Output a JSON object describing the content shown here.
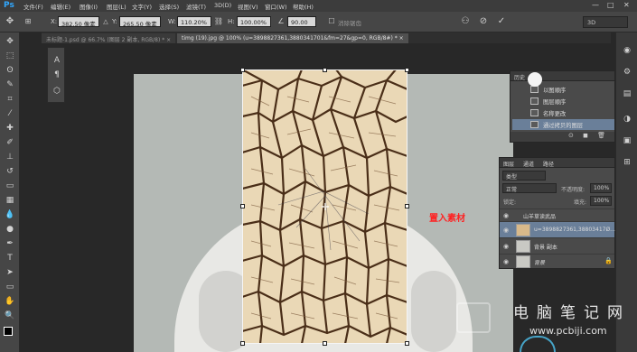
{
  "menubar": {
    "logo": "Ps",
    "items": [
      "文件(F)",
      "编辑(E)",
      "图像(I)",
      "图层(L)",
      "文字(Y)",
      "选择(S)",
      "滤镜(T)",
      "3D(D)",
      "视图(V)",
      "窗口(W)",
      "帮助(H)"
    ],
    "window_controls": [
      "—",
      "□",
      "✕"
    ]
  },
  "options": {
    "x_label": "X:",
    "x_value": "382.50 像素",
    "y_label": "Y:",
    "y_value": "265.50 像素",
    "w_label": "W:",
    "w_value": "110.20%",
    "h_label": "H:",
    "h_value": "100.00%",
    "angle_value": "90.00",
    "antialias_label": "消除锯齿",
    "workspace": "3D"
  },
  "tabs": [
    {
      "label": "未标题-1.psd @ 66.7% (图层 2 副本, RGB/8) *  ×"
    },
    {
      "label": "timg (19).jpg @ 100% (u=3898827361,3880341701&fm=27&gp=0, RGB/8#) *  ×"
    }
  ],
  "annotation": "置入素材",
  "history": {
    "tab_label": "历史",
    "rows": [
      "以图顺序",
      "图层顺序",
      "名称更改",
      "通过拷贝的图层"
    ],
    "footer": "⊙ ◼ 🗑"
  },
  "layers": {
    "tabs": [
      "图层",
      "通道",
      "路径"
    ],
    "kind": "类型",
    "blend_mode": "正常",
    "opacity_label": "不透明度:",
    "opacity_value": "100%",
    "lock_label": "锁定:",
    "fill_label": "填充:",
    "fill_value": "100%",
    "rows": [
      {
        "name": "山羊草读武品"
      },
      {
        "name": "u=3898827361,38803417Ø..."
      },
      {
        "name": "背景 副本"
      },
      {
        "name": "背景"
      }
    ]
  },
  "watermark": {
    "title": "电脑笔记网",
    "url": "www.pcbiji.com"
  },
  "colors": {
    "accent_selection": "#6a7f99",
    "annotation": "#ff2020",
    "app_dark": "#464646"
  }
}
